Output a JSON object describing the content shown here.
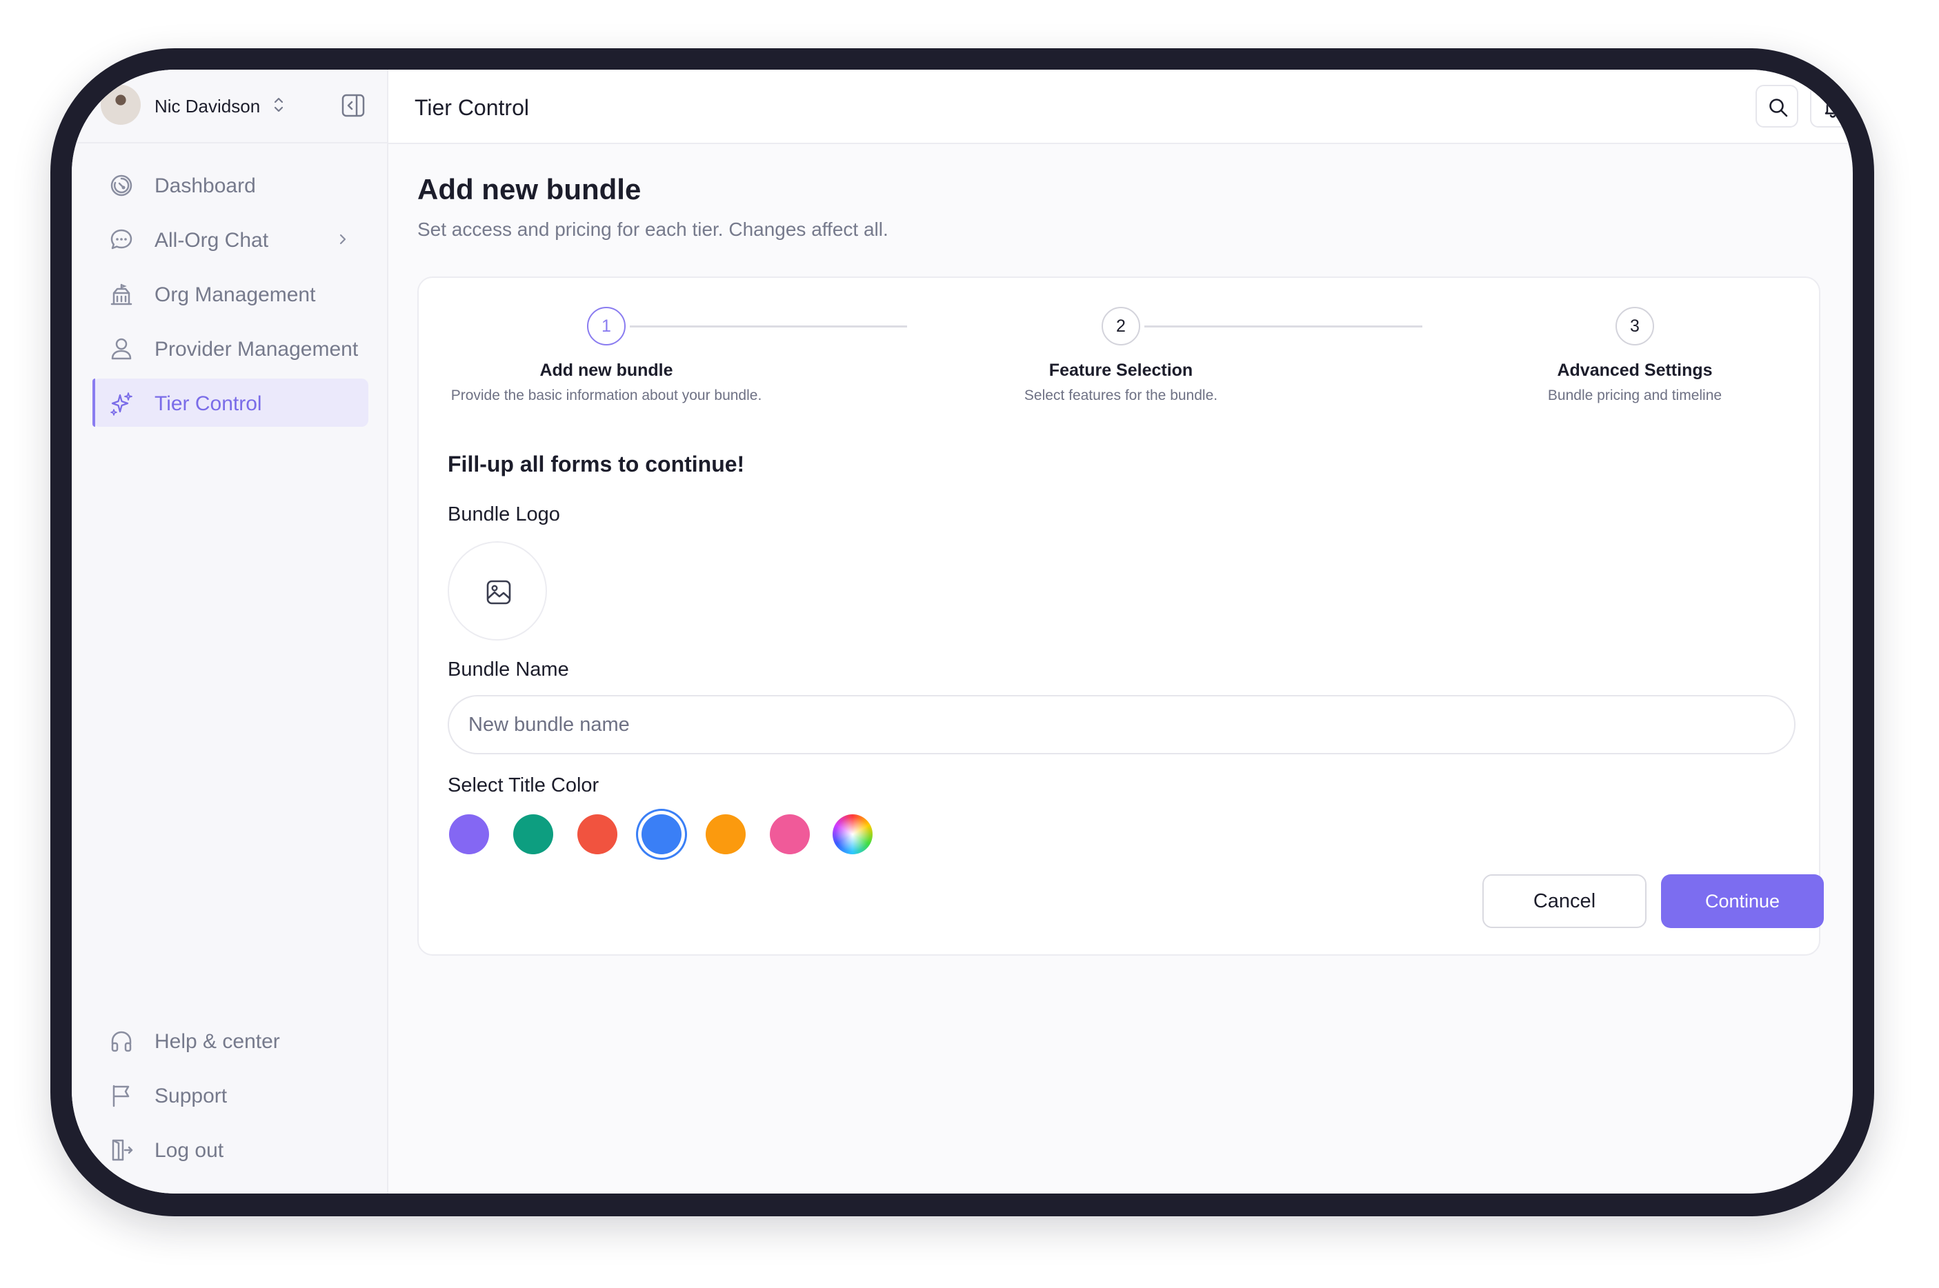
{
  "user": {
    "name": "Nic Davidson"
  },
  "sidebar": {
    "items": [
      {
        "label": "Dashboard",
        "icon": "dashboard-icon",
        "active": false
      },
      {
        "label": "All-Org Chat",
        "icon": "chat-icon",
        "has_submenu": true,
        "active": false
      },
      {
        "label": "Org Management",
        "icon": "building-icon",
        "active": false
      },
      {
        "label": "Provider Management",
        "icon": "user-icon",
        "active": false
      },
      {
        "label": "Tier Control",
        "icon": "sparkles-icon",
        "active": true
      }
    ],
    "bottom_items": [
      {
        "label": "Help & center",
        "icon": "headphones-icon"
      },
      {
        "label": "Support",
        "icon": "flag-icon"
      },
      {
        "label": "Log out",
        "icon": "logout-icon"
      }
    ]
  },
  "header": {
    "title": "Tier Control",
    "actions": [
      "search-icon",
      "bell-icon",
      "gear-icon"
    ]
  },
  "main": {
    "title": "Add new bundle",
    "subtitle": "Set access and pricing for each tier. Changes affect all.",
    "steps": [
      {
        "number": "1",
        "title": "Add new bundle",
        "description": "Provide the basic information about your bundle.",
        "active": true
      },
      {
        "number": "2",
        "title": "Feature Selection",
        "description": "Select features for the bundle.",
        "active": false
      },
      {
        "number": "3",
        "title": "Advanced Settings",
        "description": "Bundle pricing and timeline",
        "active": false
      }
    ],
    "form": {
      "heading": "Fill-up all forms to continue!",
      "logo_label": "Bundle Logo",
      "name_label": "Bundle Name",
      "name_placeholder": "New bundle name",
      "name_value": "",
      "color_label": "Select Title Color",
      "colors": [
        "#8467f3",
        "#0d9e80",
        "#f1533f",
        "#3a7ff6",
        "#fb9a0e",
        "#f05a99",
        "rainbow"
      ],
      "selected_color": "#3a7ff6"
    },
    "buttons": {
      "cancel": "Cancel",
      "continue": "Continue"
    }
  },
  "theme": {
    "accent": "#7c6df0",
    "text": "#1c1d2b",
    "muted": "#767a8c"
  }
}
